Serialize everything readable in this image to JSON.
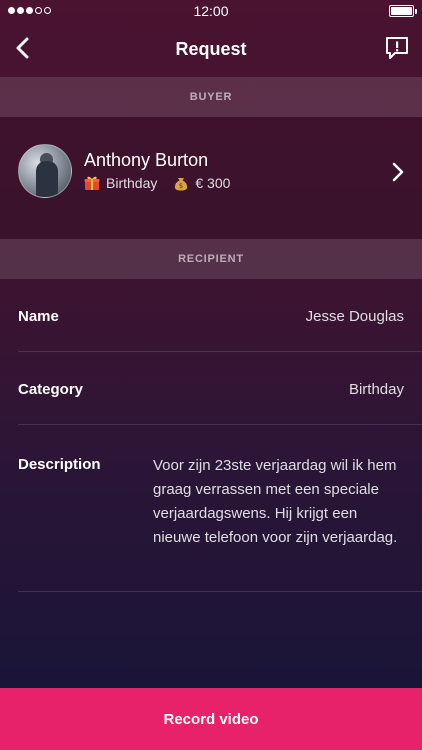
{
  "status_bar": {
    "time": "12:00",
    "signal_bars": 3,
    "signal_total": 5,
    "battery_level": 1.0
  },
  "nav": {
    "title": "Request",
    "back_icon": "chevron-left-icon",
    "report_icon": "report-icon"
  },
  "buyer_section": {
    "header": "BUYER",
    "name": "Anthony Burton",
    "occasion": "Birthday",
    "occasion_icon": "gift-icon",
    "amount": "€ 300",
    "amount_icon": "money-bag-icon"
  },
  "recipient_section": {
    "header": "RECIPIENT",
    "fields": [
      {
        "label": "Name",
        "value": "Jesse Douglas"
      },
      {
        "label": "Category",
        "value": "Birthday"
      },
      {
        "label": "Description",
        "value": "Voor zijn 23ste verjaardag wil ik hem graag verrassen met een speciale verjaardagswens. Hij krijgt een nieuwe telefoon voor zijn verjaardag."
      }
    ]
  },
  "actions": {
    "record_label": "Record video"
  },
  "colors": {
    "accent": "#e8216b",
    "bg_top": "#4a1330",
    "bg_bottom": "#141539"
  }
}
